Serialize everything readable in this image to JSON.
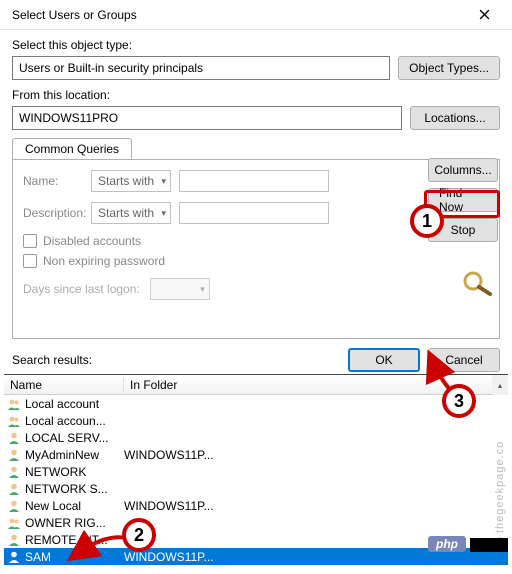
{
  "window": {
    "title": "Select Users or Groups"
  },
  "objectType": {
    "label": "Select this object type:",
    "value": "Users or Built-in security principals",
    "button": "Object Types..."
  },
  "location": {
    "label": "From this location:",
    "value": "WINDOWS11PRO",
    "button": "Locations..."
  },
  "tabs": {
    "commonQueries": "Common Queries"
  },
  "query": {
    "nameLabel": "Name:",
    "nameMode": "Starts with",
    "descLabel": "Description:",
    "descMode": "Starts with",
    "disabledAccounts": "Disabled accounts",
    "nonExpiring": "Non expiring password",
    "daysLabel": "Days since last logon:"
  },
  "rightButtons": {
    "columns": "Columns...",
    "findNow": "Find Now",
    "stop": "Stop"
  },
  "footer": {
    "searchResults": "Search results:",
    "ok": "OK",
    "cancel": "Cancel"
  },
  "columns": {
    "name": "Name",
    "inFolder": "In Folder"
  },
  "results": [
    {
      "name": "Local account",
      "folder": "",
      "icon": "group"
    },
    {
      "name": "Local accoun...",
      "folder": "",
      "icon": "group"
    },
    {
      "name": "LOCAL SERV...",
      "folder": "",
      "icon": "user"
    },
    {
      "name": "MyAdminNew",
      "folder": "WINDOWS11P...",
      "icon": "user"
    },
    {
      "name": "NETWORK",
      "folder": "",
      "icon": "user"
    },
    {
      "name": "NETWORK S...",
      "folder": "",
      "icon": "user"
    },
    {
      "name": "New Local",
      "folder": "WINDOWS11P...",
      "icon": "user"
    },
    {
      "name": "OWNER RIG...",
      "folder": "",
      "icon": "group"
    },
    {
      "name": "REMOTE INT...",
      "folder": "",
      "icon": "user"
    },
    {
      "name": "SAM",
      "folder": "WINDOWS11P...",
      "icon": "user",
      "selected": true
    }
  ],
  "annotations": {
    "one": "1",
    "two": "2",
    "three": "3"
  },
  "watermark": "©thegeekpage.co",
  "badge": "php"
}
